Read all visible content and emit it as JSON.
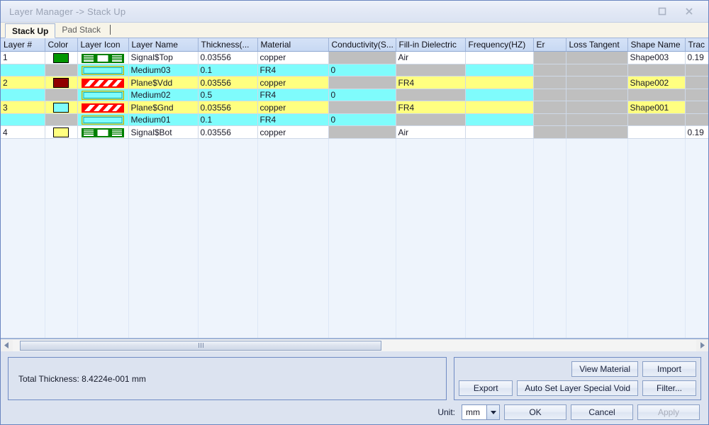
{
  "window": {
    "title": "Layer Manager -> Stack Up",
    "maximize_icon": "maximize-icon",
    "close_icon": "close-icon"
  },
  "tabs": [
    {
      "label": "Stack Up",
      "active": true
    },
    {
      "label": "Pad Stack",
      "active": false
    }
  ],
  "grid": {
    "columns": [
      "Layer #",
      "Color",
      "Layer Icon",
      "Layer Name",
      "Thickness(...",
      "Material",
      "Conductivity(S...",
      "Fill-in Dielectric",
      "Frequency(HZ)",
      "Er",
      "Loss Tangent",
      "Shape Name",
      "Trac"
    ],
    "rows": [
      {
        "kind": "signal",
        "layer_num": "1",
        "color": "#009600",
        "icon": "signal-layer-icon",
        "name": "Signal$Top",
        "thickness": "0.03556",
        "material": "copper",
        "conductivity": "",
        "conductivity_disabled": true,
        "fill_in_dielectric": "Air",
        "frequency": "",
        "er": "",
        "er_disabled": true,
        "loss_tangent": "",
        "loss_tangent_disabled": true,
        "shape_name": "Shape003",
        "trace": "0.19"
      },
      {
        "kind": "medium",
        "layer_num": "",
        "color": "",
        "color_disabled": true,
        "icon": "medium-layer-icon",
        "name": "Medium03",
        "thickness": "0.1",
        "material": "FR4",
        "conductivity": "0",
        "fill_in_dielectric": "",
        "fill_in_disabled": true,
        "frequency": "",
        "er": "",
        "er_disabled": true,
        "loss_tangent": "",
        "loss_tangent_disabled": true,
        "shape_name": "",
        "shape_disabled": true,
        "trace": "",
        "trace_disabled": true
      },
      {
        "kind": "plane",
        "layer_num": "2",
        "color": "#900000",
        "icon": "plane-layer-icon",
        "name": "Plane$Vdd",
        "thickness": "0.03556",
        "material": "copper",
        "conductivity": "",
        "conductivity_disabled": true,
        "fill_in_dielectric": "FR4",
        "frequency": "",
        "er": "",
        "er_disabled": true,
        "loss_tangent": "",
        "loss_tangent_disabled": true,
        "shape_name": "Shape002",
        "trace": "",
        "trace_disabled": true
      },
      {
        "kind": "medium",
        "layer_num": "",
        "color": "",
        "color_disabled": true,
        "icon": "medium-layer-icon",
        "name": "Medium02",
        "thickness": "0.5",
        "material": "FR4",
        "conductivity": "0",
        "fill_in_dielectric": "",
        "fill_in_disabled": true,
        "frequency": "",
        "er": "",
        "er_disabled": true,
        "loss_tangent": "",
        "loss_tangent_disabled": true,
        "shape_name": "",
        "shape_disabled": true,
        "trace": "",
        "trace_disabled": true
      },
      {
        "kind": "plane",
        "layer_num": "3",
        "color": "#7ffcfc",
        "icon": "plane-layer-icon",
        "name": "Plane$Gnd",
        "thickness": "0.03556",
        "material": "copper",
        "conductivity": "",
        "conductivity_disabled": true,
        "fill_in_dielectric": "FR4",
        "frequency": "",
        "er": "",
        "er_disabled": true,
        "loss_tangent": "",
        "loss_tangent_disabled": true,
        "shape_name": "Shape001",
        "trace": "",
        "trace_disabled": true
      },
      {
        "kind": "medium",
        "layer_num": "",
        "color": "",
        "color_disabled": true,
        "icon": "medium-layer-icon",
        "name": "Medium01",
        "thickness": "0.1",
        "material": "FR4",
        "conductivity": "0",
        "fill_in_dielectric": "",
        "fill_in_disabled": true,
        "frequency": "",
        "er": "",
        "er_disabled": true,
        "loss_tangent": "",
        "loss_tangent_disabled": true,
        "shape_name": "",
        "shape_disabled": true,
        "trace": "",
        "trace_disabled": true
      },
      {
        "kind": "signal",
        "layer_num": "4",
        "color": "#ffff80",
        "icon": "signal-layer-icon",
        "name": "Signal$Bot",
        "thickness": "0.03556",
        "material": "copper",
        "conductivity": "",
        "conductivity_disabled": true,
        "fill_in_dielectric": "Air",
        "frequency": "",
        "er": "",
        "er_disabled": true,
        "loss_tangent": "",
        "loss_tangent_disabled": true,
        "shape_name": "",
        "trace": "0.19"
      }
    ]
  },
  "scrollbar": {
    "left_arrow_icon": "scroll-left-arrow-icon",
    "right_arrow_icon": "scroll-right-arrow-icon",
    "grip_icon": "scroll-grip-icon"
  },
  "summary": {
    "total_thickness": "Total Thickness:  8.4224e-001 mm"
  },
  "buttons": {
    "view_material": "View Material",
    "import": "Import",
    "export": "Export",
    "auto_set_layer_special_void": "Auto Set Layer Special Void",
    "filter": "Filter..."
  },
  "footer": {
    "unit_label": "Unit:",
    "unit_value": "mm",
    "unit_caret_icon": "chevron-down-icon",
    "ok": "OK",
    "cancel": "Cancel",
    "apply": "Apply",
    "apply_enabled": false
  },
  "colors": {
    "window_bg": "#dce3f0",
    "header_bg": "#ccdcf4",
    "medium_row": "#7ffcfc",
    "plane_row": "#ffff80",
    "disabled_cell": "#bfbfbf",
    "border_blue": "#6f8bc4"
  }
}
